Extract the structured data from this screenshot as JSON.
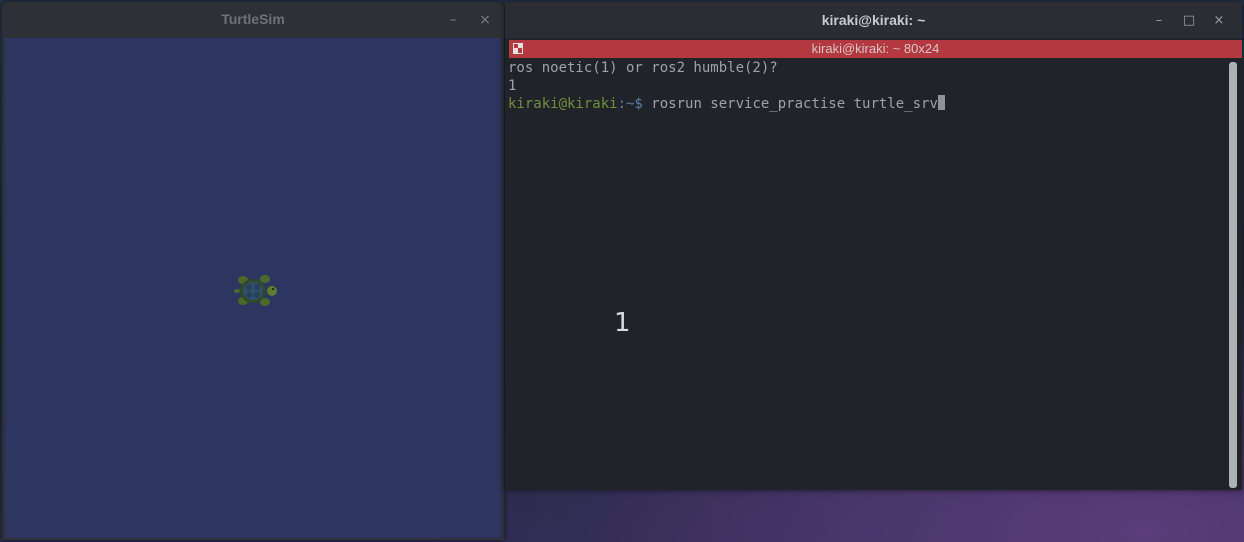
{
  "turtlesim": {
    "title": "TurtleSim",
    "minimize_icon": "–",
    "close_icon": "×",
    "background_color": "#2d3560"
  },
  "terminal": {
    "title": "kiraki@kiraki: ~",
    "tab_label": "kiraki@kiraki: ~ 80x24",
    "minimize_icon": "–",
    "maximize_icon": "□",
    "close_icon": "×",
    "lines": {
      "line1": "ros noetic(1) or ros2 humble(2)?",
      "line2": "1",
      "prompt_user": "kiraki@kiraki",
      "prompt_path": ":~$",
      "command": " rosrun service_practise turtle_srv"
    },
    "overlay_text": "1"
  },
  "colors": {
    "tab_bar": "#b4383f",
    "terminal_bg": "#202329",
    "prompt_user": "#6f8f3a"
  }
}
